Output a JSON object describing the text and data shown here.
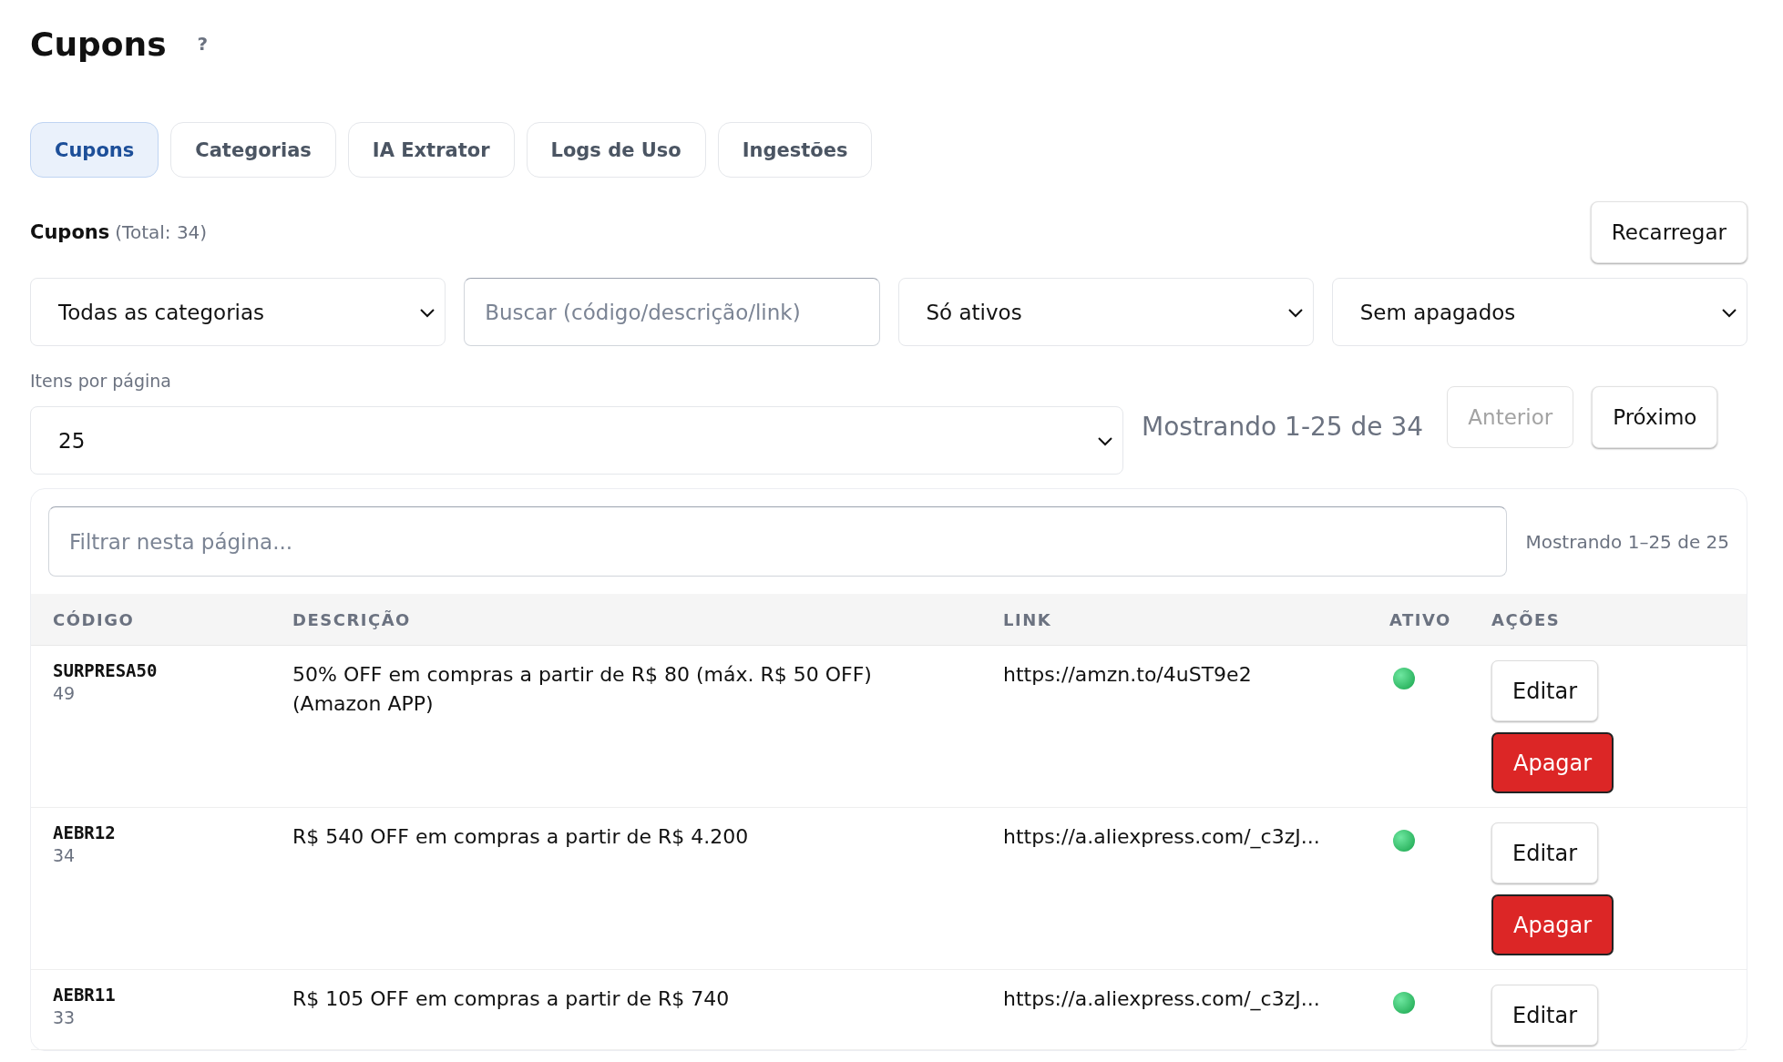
{
  "title": "Cupons",
  "help": "?",
  "tabs": [
    {
      "label": "Cupons",
      "selected": true
    },
    {
      "label": "Categorias",
      "selected": false
    },
    {
      "label": "IA Extrator",
      "selected": false
    },
    {
      "label": "Logs de Uso",
      "selected": false
    },
    {
      "label": "Ingestões",
      "selected": false
    }
  ],
  "section": {
    "title": "Cupons",
    "total": "(Total: 34)",
    "reload": "Recarregar"
  },
  "filters": [
    {
      "kind": "select",
      "value": "Todas as categorias"
    },
    {
      "kind": "input",
      "placeholder": "Buscar (código/descrição/link)"
    },
    {
      "kind": "select",
      "value": "Só ativos"
    },
    {
      "kind": "select",
      "value": "Sem apagados"
    }
  ],
  "per_page": {
    "label": "Itens por página",
    "value": "25"
  },
  "pagination": {
    "summary": "Mostrando 1-25 de 34",
    "prev": {
      "label": "Anterior",
      "disabled": true
    },
    "next": {
      "label": "Próximo",
      "disabled": false
    }
  },
  "table": {
    "filter_placeholder": "Filtrar nesta página...",
    "summary": "Mostrando 1–25 de 25",
    "columns": [
      "CÓDIGO",
      "DESCRIÇÃO",
      "LINK",
      "ATIVO",
      "AÇÕES"
    ],
    "rows": [
      {
        "code": "SURPRESA50",
        "uses": "49",
        "description": "50% OFF em compras a partir de R$ 80 (máx. R$ 50 OFF) (Amazon APP)",
        "link": "https://amzn.to/4uST9e2",
        "active": true,
        "actions": [
          {
            "kind": "edit",
            "label": "Editar"
          },
          {
            "kind": "delete",
            "label": "Apagar"
          }
        ]
      },
      {
        "code": "AEBR12",
        "uses": "34",
        "description": "R$ 540 OFF em compras a partir de R$ 4.200",
        "link": "https://a.aliexpress.com/_c3zJ...",
        "active": true,
        "actions": [
          {
            "kind": "edit",
            "label": "Editar"
          },
          {
            "kind": "delete",
            "label": "Apagar"
          }
        ]
      },
      {
        "code": "AEBR11",
        "uses": "33",
        "description": "R$ 105 OFF em compras a partir de R$ 740",
        "link": "https://a.aliexpress.com/_c3zJ...",
        "active": true,
        "actions": [
          {
            "kind": "edit",
            "label": "Editar"
          }
        ]
      }
    ]
  }
}
